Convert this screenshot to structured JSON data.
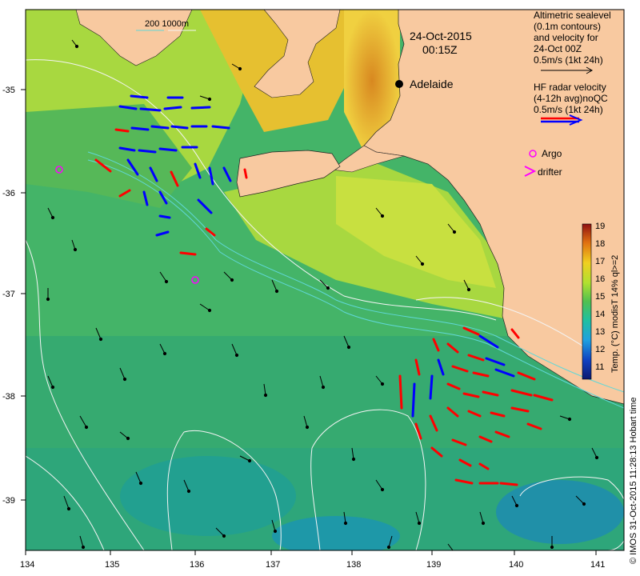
{
  "map": {
    "date": "24-Oct-2015",
    "time": "00:15Z",
    "scale_bar": "200  1000m",
    "city": "Adelaide",
    "colors": {
      "land": "#f8c9a0",
      "sea_dark": "#2fa86a",
      "sea_mid": "#5cc060",
      "shelf": "#b8e040",
      "warm": "#e8a020",
      "hf_red": "#ff0000",
      "hf_blue": "#0000ff",
      "argo": "#ff00ff"
    }
  },
  "legend": {
    "alt_title": [
      "Altimetric sealevel",
      "(0.1m contours)",
      "and velocity for",
      "24-Oct 00Z",
      "0.5m/s (1kt 24h)"
    ],
    "hf_title": [
      "HF radar velocity",
      "(4-12h avg)noQC",
      "0.5m/s (1kt 24h)"
    ],
    "argo": "Argo",
    "drifter": "drifter"
  },
  "colorbar": {
    "ticks": [
      "19",
      "18",
      "17",
      "16",
      "15",
      "14",
      "13",
      "12",
      "11"
    ],
    "label": "Temp. (°C) modisT 14% ql>=2"
  },
  "axes": {
    "x_ticks": [
      "134",
      "135",
      "136",
      "137",
      "138",
      "139",
      "140",
      "141"
    ],
    "y_ticks": [
      "-35",
      "-36",
      "-37",
      "-38",
      "-39"
    ]
  },
  "credit": "© IMOS 31-Oct-2015 11:28:13 Hobart time"
}
